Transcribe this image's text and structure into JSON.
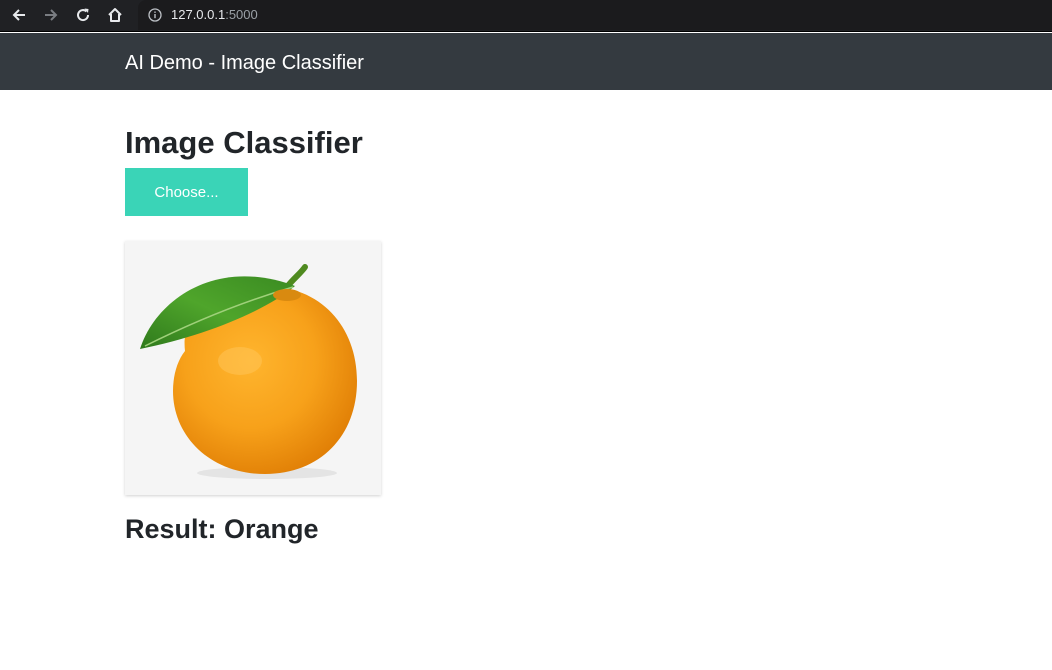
{
  "browser": {
    "url_host": "127.0.0.1",
    "url_port": ":5000"
  },
  "navbar": {
    "brand": "AI Demo - Image Classifier"
  },
  "main": {
    "title": "Image Classifier",
    "choose_button": "Choose...",
    "image_subject": "orange-fruit-with-leaf",
    "result_text": "Result: Orange"
  },
  "colors": {
    "navbar_bg": "#343a40",
    "button_accent": "#3ad4b7",
    "text_dark": "#212529"
  }
}
